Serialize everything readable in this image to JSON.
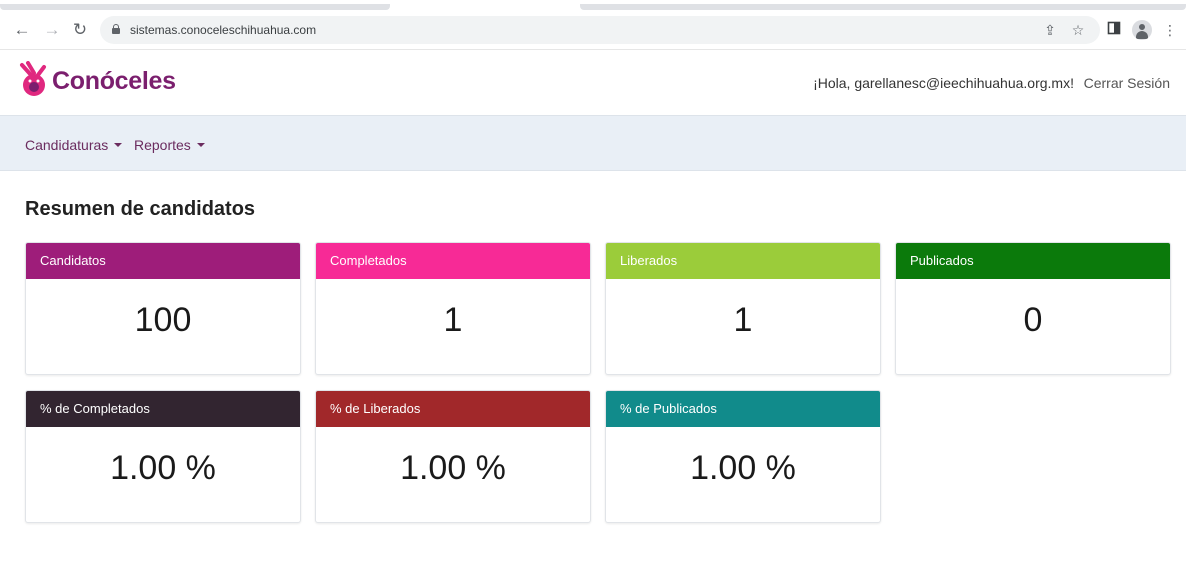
{
  "browser": {
    "url": "sistemas.conoceleschihuahua.com"
  },
  "header": {
    "brand": "Conóceles",
    "greeting": "¡Hola, garellanesc@ieechihuahua.org.mx!",
    "logout": "Cerrar Sesión"
  },
  "nav": {
    "items": [
      {
        "label": "Candidaturas"
      },
      {
        "label": "Reportes"
      }
    ]
  },
  "main": {
    "title": "Resumen de candidatos",
    "cards": [
      {
        "label": "Candidatos",
        "value": "100",
        "color": "#9e1d7a"
      },
      {
        "label": "Completados",
        "value": "1",
        "color": "#f72a96"
      },
      {
        "label": "Liberados",
        "value": "1",
        "color": "#9bcc3a"
      },
      {
        "label": "Publicados",
        "value": "0",
        "color": "#0b7a0b"
      },
      {
        "label": "% de Completados",
        "value": "1.00 %",
        "color": "#322530"
      },
      {
        "label": "% de Liberados",
        "value": "1.00 %",
        "color": "#a1282a"
      },
      {
        "label": "% de Publicados",
        "value": "1.00 %",
        "color": "#118b8b"
      }
    ]
  },
  "icons": {
    "back": "back-arrow-icon",
    "forward": "forward-arrow-icon",
    "reload": "reload-icon",
    "lock": "lock-icon",
    "share": "share-icon",
    "bookmark": "star-icon",
    "sidepanel": "side-panel-icon",
    "profile": "profile-icon",
    "menu": "kebab-menu-icon"
  }
}
